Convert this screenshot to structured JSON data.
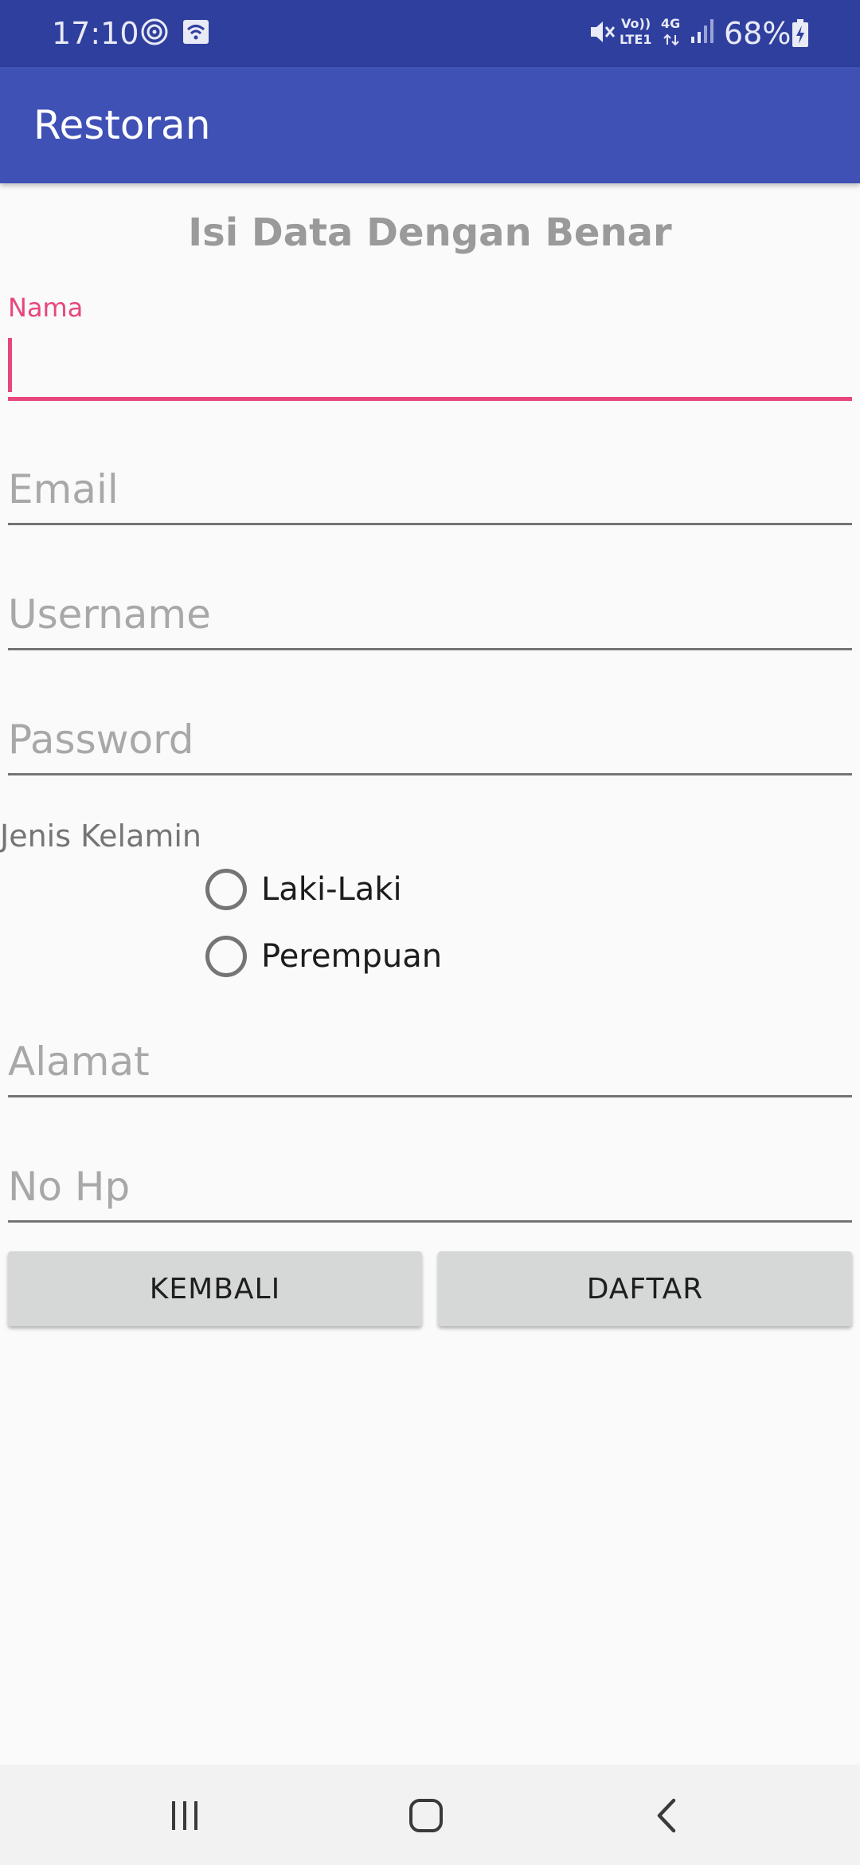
{
  "status_bar": {
    "time": "17:10",
    "battery": "68%",
    "network_volte": "Vo))",
    "network_lte": "LTE1",
    "network_gen": "4G",
    "icons": [
      "sync-icon",
      "wifi-screen-icon",
      "mute-icon",
      "volte-icon",
      "data-4g-icon",
      "signal-icon",
      "battery-charging-icon"
    ]
  },
  "app_bar": {
    "title": "Restoran"
  },
  "form": {
    "heading": "Isi Data Dengan Benar",
    "nama_label": "Nama",
    "nama_value": "",
    "email_placeholder": "Email",
    "username_placeholder": "Username",
    "password_placeholder": "Password",
    "gender_label": "Jenis Kelamin",
    "gender_options": [
      "Laki-Laki",
      "Perempuan"
    ],
    "alamat_placeholder": "Alamat",
    "nohp_placeholder": "No Hp"
  },
  "buttons": {
    "back": "KEMBALI",
    "register": "DAFTAR"
  },
  "nav_bar": {
    "icons": [
      "recent-apps-icon",
      "home-icon",
      "back-icon"
    ]
  },
  "colors": {
    "status_bar": "#2f3f9e",
    "app_bar": "#3f51b5",
    "accent": "#e8467e",
    "button": "#d6d7d7",
    "background": "#fafafa"
  }
}
